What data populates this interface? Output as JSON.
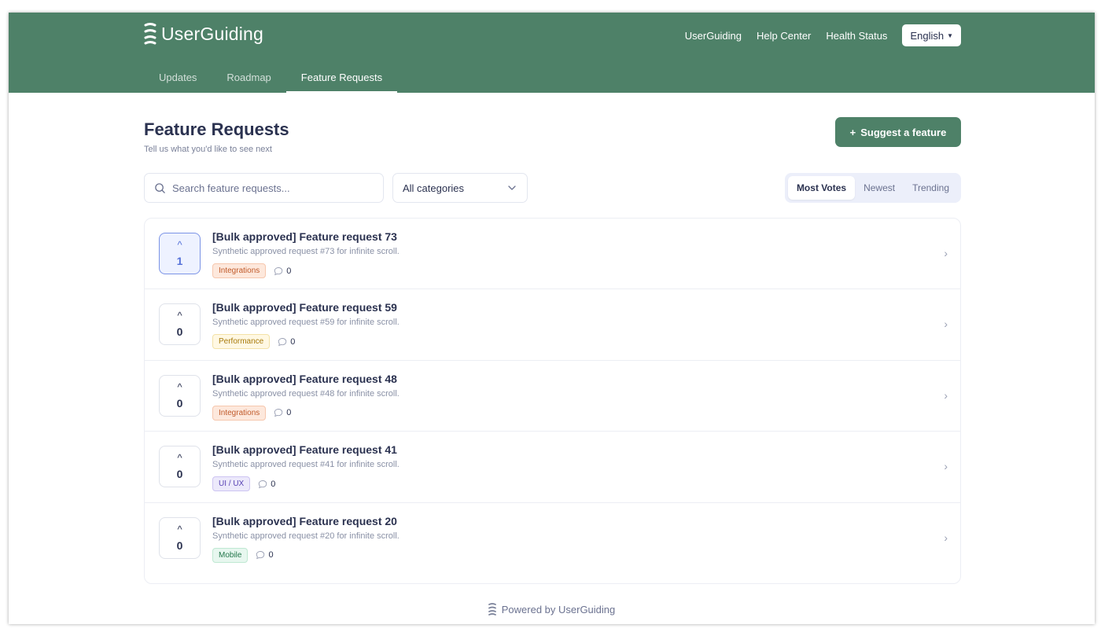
{
  "brand": {
    "name": "UserGuiding",
    "color": "#4e8168"
  },
  "header": {
    "links": [
      "UserGuiding",
      "Help Center",
      "Health Status"
    ],
    "language": "English",
    "tabs": [
      "Updates",
      "Roadmap",
      "Feature Requests"
    ],
    "active_tab": "Feature Requests"
  },
  "page": {
    "title": "Feature Requests",
    "subtitle": "Tell us what you'd like to see next",
    "suggest_label": "Suggest a feature"
  },
  "filters": {
    "search_placeholder": "Search feature requests...",
    "category": "All categories",
    "sort_options": [
      "Most Votes",
      "Newest",
      "Trending"
    ],
    "active_sort": "Most Votes"
  },
  "requests": [
    {
      "title": "[Bulk approved] Feature request 73",
      "description": "Synthetic approved request #73 for infinite scroll.",
      "votes": "1",
      "voted": true,
      "tag": "Integrations",
      "tag_style": "integrations",
      "comments": "0"
    },
    {
      "title": "[Bulk approved] Feature request 59",
      "description": "Synthetic approved request #59 for infinite scroll.",
      "votes": "0",
      "voted": false,
      "tag": "Performance",
      "tag_style": "performance",
      "comments": "0"
    },
    {
      "title": "[Bulk approved] Feature request 48",
      "description": "Synthetic approved request #48 for infinite scroll.",
      "votes": "0",
      "voted": false,
      "tag": "Integrations",
      "tag_style": "integrations",
      "comments": "0"
    },
    {
      "title": "[Bulk approved] Feature request 41",
      "description": "Synthetic approved request #41 for infinite scroll.",
      "votes": "0",
      "voted": false,
      "tag": "UI / UX",
      "tag_style": "uiux",
      "comments": "0"
    },
    {
      "title": "[Bulk approved] Feature request 20",
      "description": "Synthetic approved request #20 for infinite scroll.",
      "votes": "0",
      "voted": false,
      "tag": "Mobile",
      "tag_style": "mobile",
      "comments": "0"
    }
  ],
  "footer": {
    "text": "Powered by UserGuiding"
  },
  "icons": {
    "search": "search-icon",
    "chevron": "chevron-down-icon",
    "comment": "comment-icon",
    "upvote": "upvote-icon",
    "row_chevron": "chevron-right-icon"
  }
}
